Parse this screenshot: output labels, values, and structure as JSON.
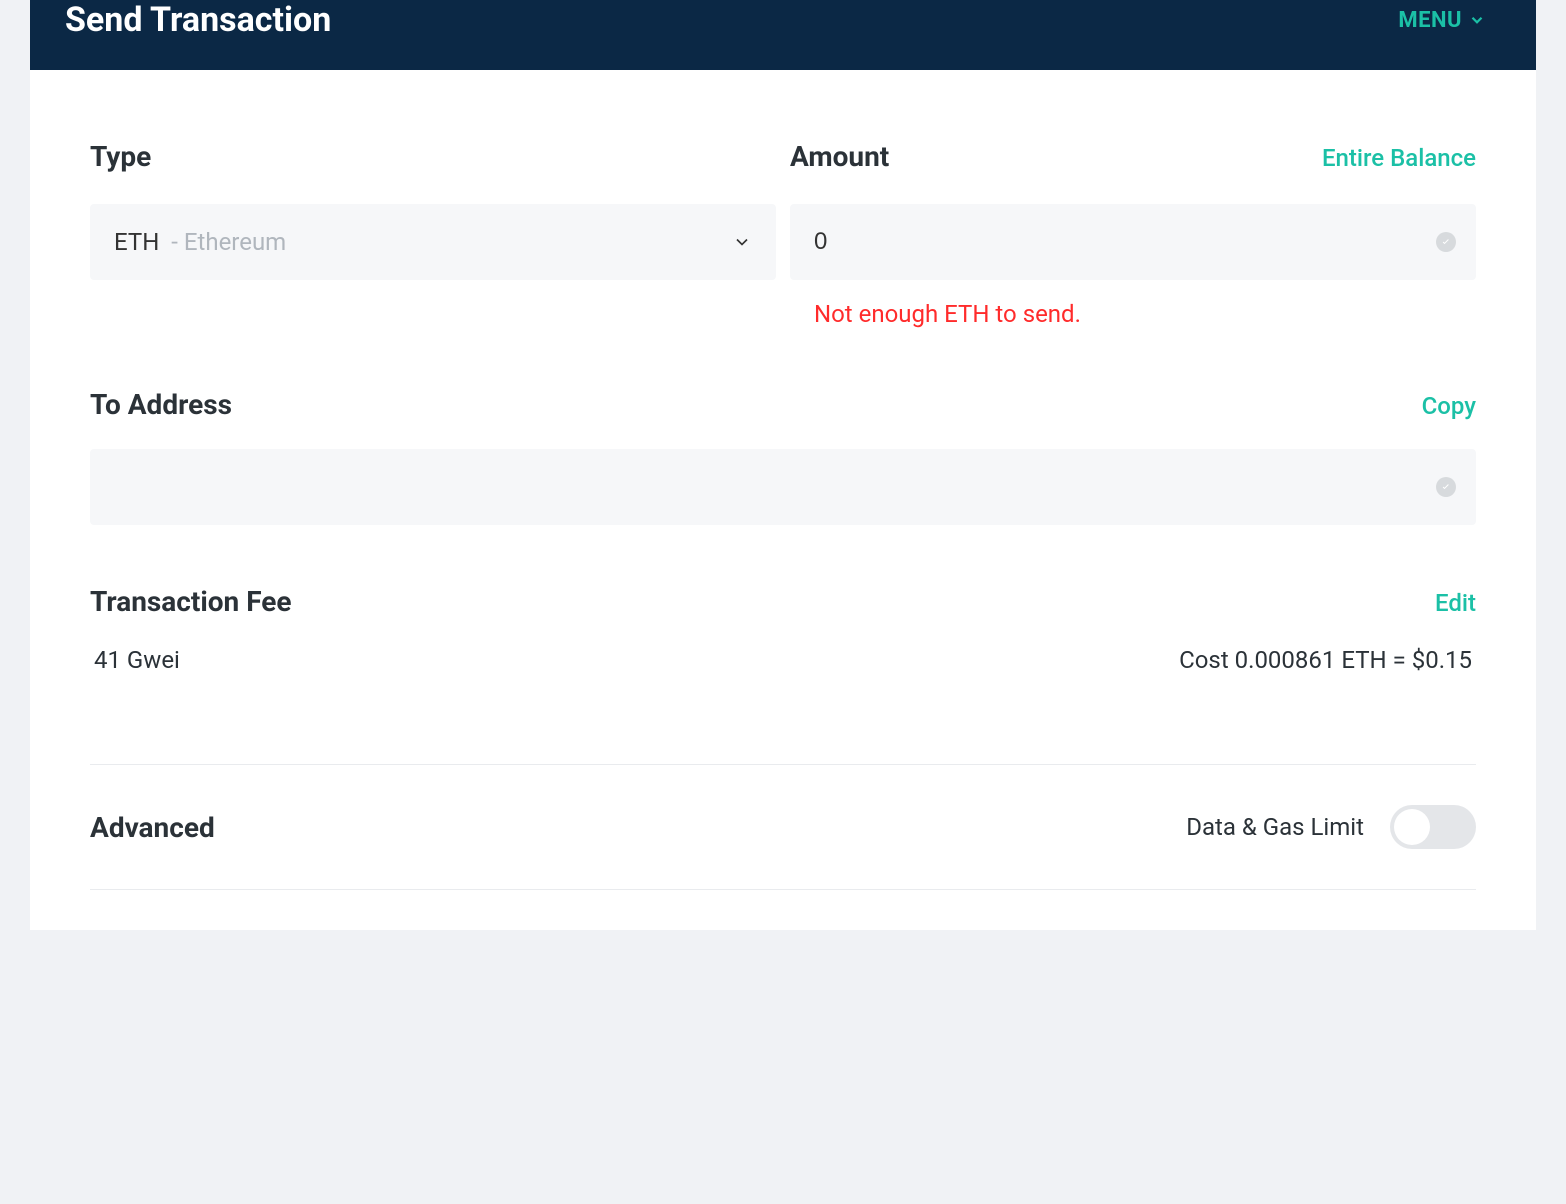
{
  "header": {
    "title": "Send Transaction",
    "menu_label": "MENU"
  },
  "type": {
    "label": "Type",
    "selected_symbol": "ETH",
    "selected_name": "- Ethereum"
  },
  "amount": {
    "label": "Amount",
    "entire_balance": "Entire Balance",
    "value": "0",
    "error": "Not enough ETH to send."
  },
  "to_address": {
    "label": "To Address",
    "copy": "Copy",
    "value": ""
  },
  "fee": {
    "label": "Transaction Fee",
    "edit": "Edit",
    "gwei": "41 Gwei",
    "cost": "Cost 0.000861 ETH = $0.15"
  },
  "advanced": {
    "label": "Advanced",
    "toggle_label": "Data & Gas Limit"
  }
}
